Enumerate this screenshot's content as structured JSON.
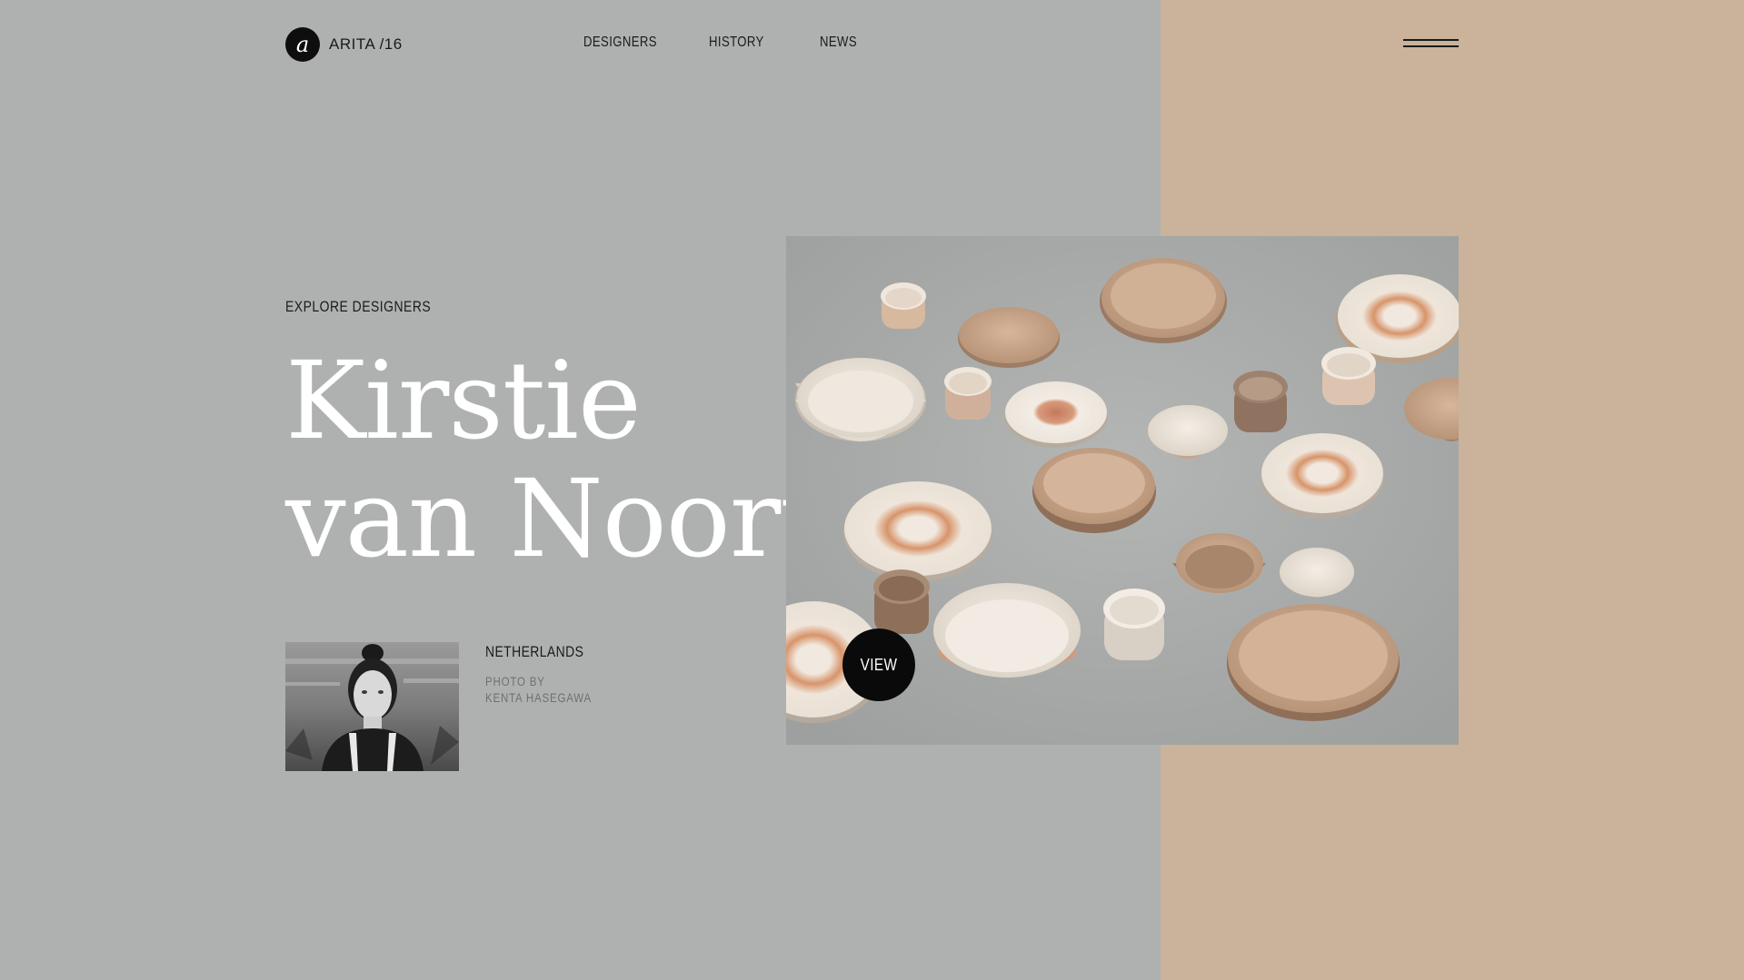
{
  "header": {
    "logo_glyph": "a",
    "logo_text": "ARITA /16",
    "nav": [
      "DESIGNERS",
      "HISTORY",
      "NEWS"
    ],
    "menu_icon": "hamburger-icon"
  },
  "hero": {
    "eyebrow": "EXPLORE DESIGNERS",
    "name_line1": "Kirstie",
    "name_line2": "van Noort"
  },
  "designer": {
    "country": "NETHERLANDS",
    "credit_line1": "PHOTO BY",
    "credit_line2": "KENTA HASEGAWA"
  },
  "feature": {
    "view_label": "VIEW"
  },
  "colors": {
    "background": "#afb1b0",
    "accent_panel": "#cab39a",
    "headline": "#ffffff",
    "dark": "#0a0a0a"
  }
}
